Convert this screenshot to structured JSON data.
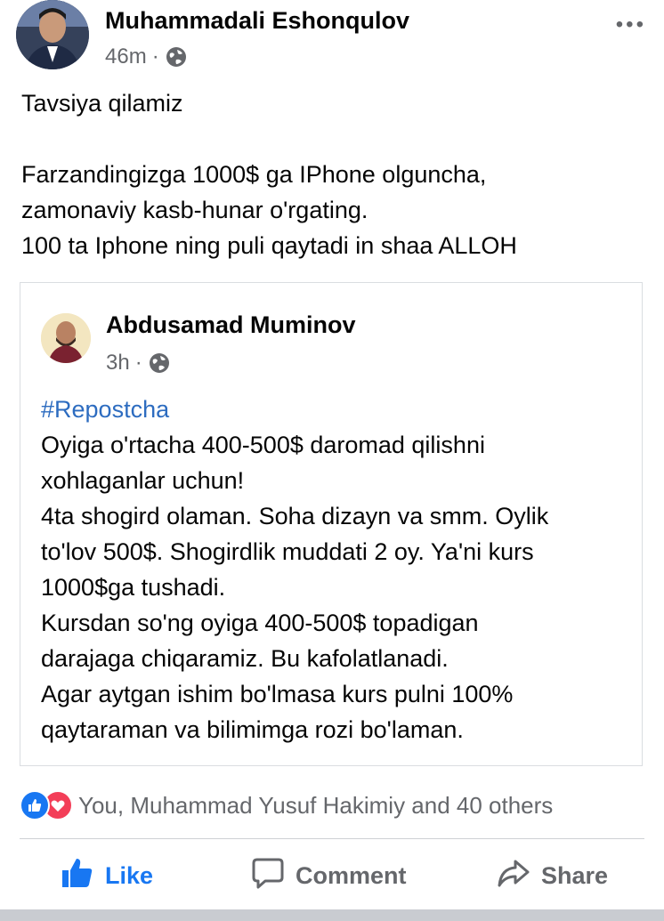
{
  "post": {
    "author": "Muhammadali Eshonqulov",
    "time": "46m",
    "separator": "·",
    "more_label": "•••",
    "lines": [
      "Tavsiya qilamiz",
      "",
      "Farzandingizga 1000$ ga IPhone olguncha,",
      "zamonaviy kasb-hunar o'rgating.",
      "100 ta Iphone ning puli qaytadi in shaa ALLOH"
    ]
  },
  "shared": {
    "author": "Abdusamad Muminov",
    "time": "3h",
    "separator": "·",
    "hashtag": "#Repostcha",
    "lines": [
      "Oyiga o'rtacha 400-500$ daromad qilishni",
      "xohlaganlar uchun!",
      "4ta shogird olaman. Soha dizayn va smm. Oylik",
      "to'lov 500$. Shogirdlik muddati 2 oy. Ya'ni kurs",
      "1000$ga tushadi.",
      "Kursdan so'ng oyiga 400-500$ topadigan",
      "darajaga chiqaramiz. Bu kafolatlanadi.",
      "Agar aytgan ishim bo'lmasa kurs pulni 100%",
      "qaytaraman va bilimimga rozi bo'laman."
    ]
  },
  "reactions": {
    "summary": "You, Muhammad Yusuf Hakimiy and 40 others",
    "types": [
      "like",
      "love"
    ]
  },
  "actions": {
    "like": "Like",
    "comment": "Comment",
    "share": "Share"
  },
  "colors": {
    "accent": "#1877f2",
    "hashtag": "#2d6cc0",
    "muted": "#65676b",
    "love": "#f33e58"
  },
  "icons": [
    "globe-icon",
    "more-icon",
    "like-reaction-icon",
    "love-reaction-icon",
    "thumbs-up-icon",
    "comment-icon",
    "share-icon"
  ]
}
